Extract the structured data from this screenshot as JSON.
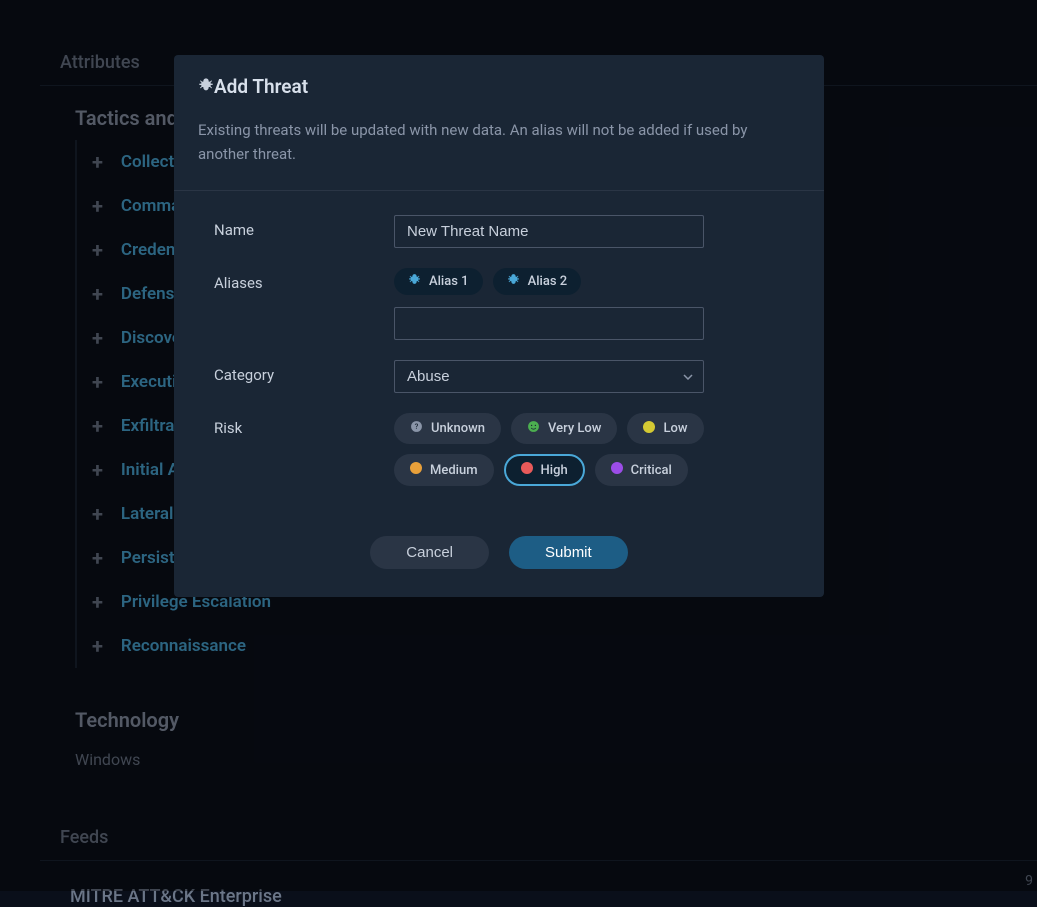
{
  "sections": {
    "attributes": {
      "title": "Attributes"
    },
    "tactics": {
      "title": "Tactics and Techniques",
      "items": [
        "Collection",
        "Command and Control",
        "Credential Access",
        "Defense Evasion",
        "Discovery",
        "Execution",
        "Exfiltration",
        "Initial Access",
        "Lateral Movement",
        "Persistence",
        "Privilege Escalation",
        "Reconnaissance"
      ]
    },
    "technology": {
      "title": "Technology",
      "items": [
        "Windows"
      ]
    },
    "feeds": {
      "title": "Feeds",
      "items": [
        "MITRE ATT&CK Enterprise"
      ],
      "count": "9"
    }
  },
  "modal": {
    "title": "Add Threat",
    "subtext": "Existing threats will be updated with new data. An alias will not be added if used by another threat.",
    "fields": {
      "name": {
        "label": "Name",
        "value": "New Threat Name"
      },
      "aliases": {
        "label": "Aliases",
        "chips": [
          "Alias 1",
          "Alias 2"
        ],
        "input_value": ""
      },
      "category": {
        "label": "Category",
        "selected": "Abuse"
      },
      "risk": {
        "label": "Risk",
        "options": [
          {
            "label": "Unknown",
            "kind": "unknown",
            "color": "#8a95a8"
          },
          {
            "label": "Very Low",
            "kind": "face",
            "color": "#4caf50"
          },
          {
            "label": "Low",
            "kind": "dot",
            "color": "#d4c933"
          },
          {
            "label": "Medium",
            "kind": "dot",
            "color": "#e8a03a"
          },
          {
            "label": "High",
            "kind": "dot",
            "color": "#e85a5a",
            "selected": true
          },
          {
            "label": "Critical",
            "kind": "dot",
            "color": "#9c4de8"
          }
        ]
      }
    },
    "buttons": {
      "cancel": "Cancel",
      "submit": "Submit"
    }
  }
}
